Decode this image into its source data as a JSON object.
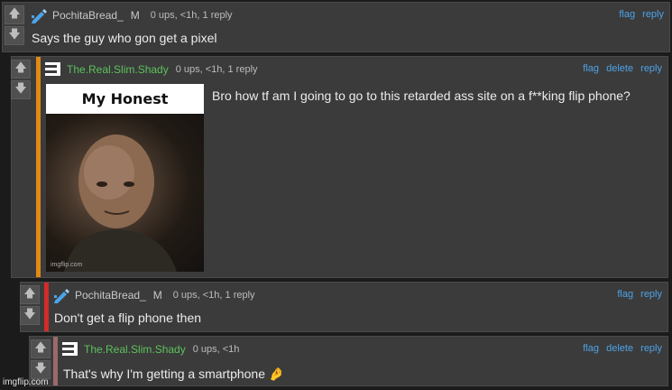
{
  "comments": [
    {
      "username": "PochitaBread_",
      "badge": "M",
      "meta": "0 ups, <1h, 1 reply",
      "actions": {
        "flag": "flag",
        "reply": "reply"
      },
      "text": "Says the guy who gon get a pixel",
      "avatar": "pencil-icon"
    },
    {
      "username": "The.Real.Slim.Shady",
      "meta": "0 ups, <1h, 1 reply",
      "actions": {
        "flag": "flag",
        "delete": "delete",
        "reply": "reply"
      },
      "text": "Bro how tf am I going to go to this retarded ass site on a f**king flip phone?",
      "avatar": "menu-icon",
      "accent_color": "#e08a15",
      "image": {
        "title": "My Honest Reaction",
        "caption": "imgflip.com"
      }
    },
    {
      "username": "PochitaBread_",
      "badge": "M",
      "meta": "0 ups, <1h, 1 reply",
      "actions": {
        "flag": "flag",
        "reply": "reply"
      },
      "text": "Don't get a flip phone then",
      "avatar": "pencil-icon",
      "accent_color": "#d42b2b"
    },
    {
      "username": "The.Real.Slim.Shady",
      "meta": "0 ups, <1h",
      "actions": {
        "flag": "flag",
        "delete": "delete",
        "reply": "reply"
      },
      "text": "That's why I'm getting a smartphone",
      "avatar": "menu-icon",
      "accent_color": "#9a6a6a"
    }
  ],
  "colors": {
    "link": "#4da3e8",
    "green_user": "#5bc25b"
  },
  "watermark": "imgflip.com"
}
